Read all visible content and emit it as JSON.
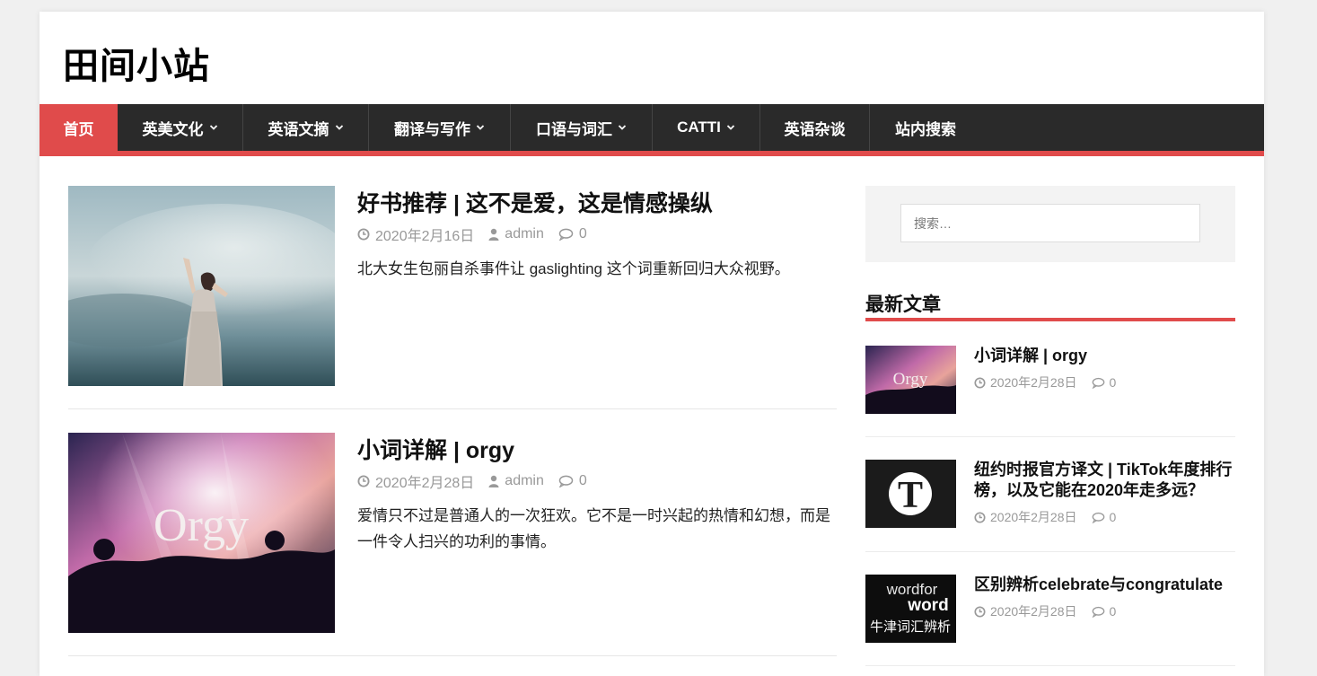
{
  "site": {
    "title": "田间小站"
  },
  "nav": {
    "items": [
      {
        "label": "首页",
        "dropdown": false,
        "active": true
      },
      {
        "label": "英美文化",
        "dropdown": true
      },
      {
        "label": "英语文摘",
        "dropdown": true
      },
      {
        "label": "翻译与写作",
        "dropdown": true
      },
      {
        "label": "口语与词汇",
        "dropdown": true
      },
      {
        "label": "CATTI",
        "dropdown": true
      },
      {
        "label": "英语杂谈",
        "dropdown": false
      },
      {
        "label": "站内搜索",
        "dropdown": false
      }
    ]
  },
  "posts": [
    {
      "title": "好书推荐 | 这不是爱，这是情感操纵",
      "date": "2020年2月16日",
      "author": "admin",
      "comments": "0",
      "excerpt": "北大女生包丽自杀事件让 gaslighting 这个词重新回归大众视野。"
    },
    {
      "title": "小词详解 | orgy",
      "date": "2020年2月28日",
      "author": "admin",
      "comments": "0",
      "excerpt": "爱情只不过是普通人的一次狂欢。它不是一时兴起的热情和幻想，而是一件令人扫兴的功利的事情。",
      "image_text": "Orgy"
    }
  ],
  "sidebar": {
    "search_placeholder": "搜索…",
    "recent_title": "最新文章",
    "recent": [
      {
        "title": "小词详解 | orgy",
        "date": "2020年2月28日",
        "comments": "0",
        "image_text": "Orgy"
      },
      {
        "title": "纽约时报官方译文 | TikTok年度排行榜，以及它能在2020年走多远？",
        "date": "2020年2月28日",
        "comments": "0",
        "image_text": "T"
      },
      {
        "title": "区别辨析celebrate与congratulate",
        "date": "2020年2月28日",
        "comments": "0",
        "image_text_1": "wordfor",
        "image_text_2": "word",
        "image_text_3": "牛津词汇辨析"
      }
    ]
  },
  "colors": {
    "accent": "#e04b4b",
    "nav_bg": "#2a2a2a",
    "meta": "#999999"
  },
  "icons": {
    "date": "clock-icon",
    "author": "user-icon",
    "comments": "comment-icon",
    "dropdown": "chevron-down-icon"
  }
}
